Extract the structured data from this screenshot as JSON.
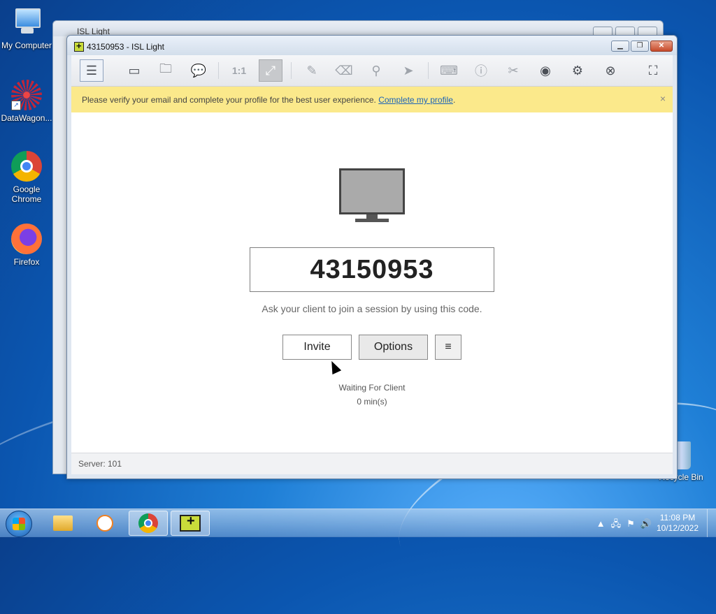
{
  "desktop": {
    "icons": [
      {
        "label": "My Computer"
      },
      {
        "label": "DataWagon..."
      },
      {
        "label": "Google Chrome"
      },
      {
        "label": "Firefox"
      },
      {
        "label": "Recycle Bin"
      }
    ]
  },
  "back_window": {
    "title": "ISL Light"
  },
  "window": {
    "title": "43150953 - ISL Light",
    "toolbar": {
      "icons": [
        "menu-list-icon",
        "monitor-icon",
        "folder-icon",
        "chat-icon",
        "one-to-one-label",
        "fit-screen-icon",
        "pencil-icon",
        "eraser-icon",
        "pin-icon",
        "pointer-icon",
        "keyboard-icon",
        "info-icon",
        "tools-icon",
        "record-icon",
        "gear-icon",
        "disconnect-icon",
        "fullscreen-icon"
      ],
      "one_to_one_label": "1:1"
    },
    "banner": {
      "text": "Please verify your email and complete your profile for the best user experience. ",
      "link": "Complete my profile",
      "suffix": ".",
      "close": "×"
    },
    "session": {
      "code": "43150953",
      "hint": "Ask your client to join a session by using this code.",
      "invite_label": "Invite",
      "options_label": "Options",
      "menu_label": "≡",
      "status": "Waiting For Client",
      "elapsed": "0 min(s)"
    },
    "footer": {
      "server": "Server: 101"
    }
  },
  "taskbar": {
    "time": "11:08 PM",
    "date": "10/12/2022"
  }
}
